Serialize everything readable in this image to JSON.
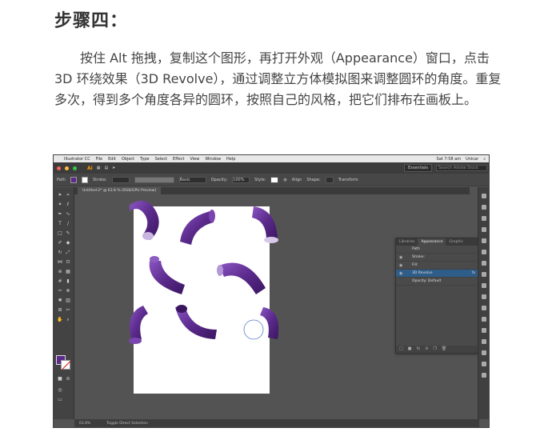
{
  "doc": {
    "heading": "步骤四：",
    "paragraph": "按住 Alt 拖拽，复制这个图形，再打开外观（Appearance）窗口，点击 3D 环绕效果（3D Revolve），通过调整立方体模拟图来调整圆环的角度。重复多次，得到多个角度各异的圆环，按照自己的风格，把它们排布在画板上。"
  },
  "screenshot": {
    "mac_menu": {
      "apple": "",
      "items": [
        "Illustrator CC",
        "File",
        "Edit",
        "Object",
        "Type",
        "Select",
        "Effect",
        "View",
        "Window",
        "Help"
      ],
      "clock": "Sat 7:58 am",
      "user": "Unicar"
    },
    "app_bar": {
      "logo": "Ai",
      "workspace": "Essentials",
      "search_placeholder": "Search Adobe Stock"
    },
    "control_bar": {
      "selection": "Path",
      "stroke_label": "Stroke:",
      "style_label": "Basic",
      "opacity_label": "Opacity:",
      "opacity_value": "100%",
      "style2_label": "Style:",
      "align_label": "Align",
      "shape_label": "Shape:",
      "transform_label": "Transform"
    },
    "doc_tab": "Untitled-2* @ 63.8 % (RGB/GPU Preview)",
    "status": {
      "zoom": "63.8%",
      "tool": "Toggle Direct Selection"
    },
    "appearance_panel": {
      "tabs": [
        "Libraries",
        "Appearance",
        "Graphic"
      ],
      "rows": [
        {
          "label": "Path"
        },
        {
          "label": "Stroke:"
        },
        {
          "label": "Fill:"
        },
        {
          "label": "3D Revolve",
          "fx": "fx"
        },
        {
          "label": "Opacity: Default"
        }
      ]
    },
    "colors": {
      "accent_purple": "#5b2a8c",
      "ui_dark": "#535353",
      "artboard": "#ffffff"
    }
  }
}
